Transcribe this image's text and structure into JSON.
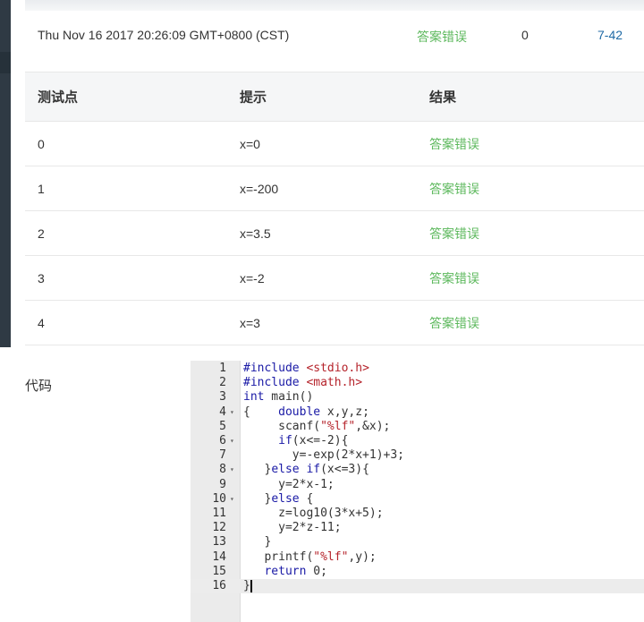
{
  "submission": {
    "time": "Thu Nov 16 2017 20:26:09 GMT+0800 (CST)",
    "status": "答案错误",
    "score": "0",
    "problem": "7-42"
  },
  "testcases": {
    "headers": [
      "测试点",
      "提示",
      "结果"
    ],
    "rows": [
      {
        "id": "0",
        "hint": "x=0",
        "result": "答案错误"
      },
      {
        "id": "1",
        "hint": "x=-200",
        "result": "答案错误"
      },
      {
        "id": "2",
        "hint": "x=3.5",
        "result": "答案错误"
      },
      {
        "id": "3",
        "hint": "x=-2",
        "result": "答案错误"
      },
      {
        "id": "4",
        "hint": "x=3",
        "result": "答案错误"
      }
    ]
  },
  "code": {
    "label": "代码",
    "lines": [
      "#include <stdio.h>",
      "#include <math.h>",
      "int main()",
      "{    double x,y,z;",
      "     scanf(\"%lf\",&x);",
      "     if(x<=-2){",
      "       y=-exp(2*x+1)+3;",
      "   }else if(x<=3){",
      "     y=2*x-1;",
      "   }else {",
      "     z=log10(3*x+5);",
      "     y=2*z-11;",
      "   }",
      "   printf(\"%lf\",y);",
      "   return 0;",
      "}"
    ],
    "fold_lines": [
      4,
      6,
      8,
      10
    ],
    "active_line": 16
  }
}
